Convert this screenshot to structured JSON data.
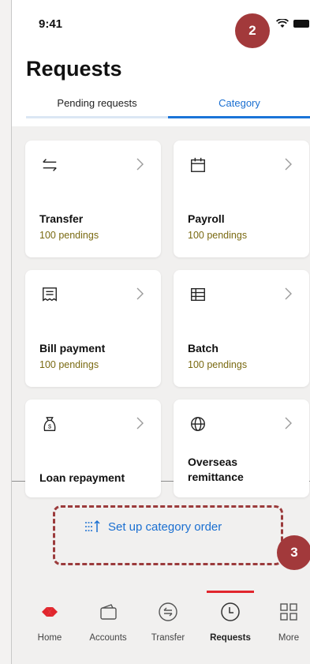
{
  "status": {
    "time": "9:41"
  },
  "page": {
    "title": "Requests"
  },
  "tabs": [
    {
      "label": "Pending requests"
    },
    {
      "label": "Category"
    }
  ],
  "categories": [
    {
      "name": "Transfer",
      "count": "100 pendings",
      "icon": "transfer-arrows-icon"
    },
    {
      "name": "Payroll",
      "count": "100 pendings",
      "icon": "calendar-icon"
    },
    {
      "name": "Bill payment",
      "count": "100 pendings",
      "icon": "bill-icon"
    },
    {
      "name": "Batch",
      "count": "100 pendings",
      "icon": "batch-grid-icon"
    },
    {
      "name": "Loan repayment",
      "count": "",
      "icon": "money-bag-icon"
    },
    {
      "name": "Overseas remittance",
      "count": "",
      "icon": "globe-icon"
    }
  ],
  "setup": {
    "label": "Set up category order"
  },
  "annotations": {
    "badge_2": "2",
    "badge_3": "3"
  },
  "nav": [
    {
      "label": "Home"
    },
    {
      "label": "Accounts"
    },
    {
      "label": "Transfer"
    },
    {
      "label": "Requests"
    },
    {
      "label": "More"
    }
  ],
  "colors": {
    "accent": "#1a6fd1",
    "brand": "#e1262d",
    "badge": "#a2393b",
    "pending": "#7a6a12"
  }
}
